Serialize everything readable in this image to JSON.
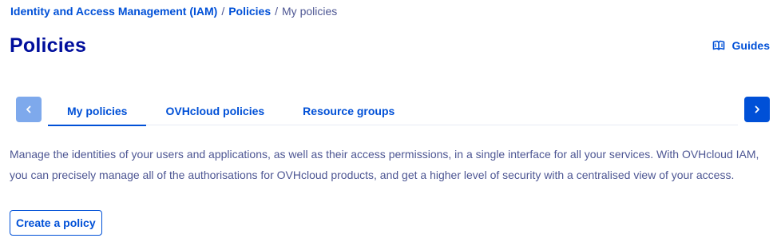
{
  "breadcrumb": {
    "items": [
      {
        "label": "Identity and Access Management (IAM)"
      },
      {
        "label": "Policies"
      }
    ],
    "separator": "/",
    "current": "My policies"
  },
  "page": {
    "title": "Policies"
  },
  "header_actions": {
    "guides_label": "Guides",
    "guides_icon": "book-icon"
  },
  "tabs": {
    "items": [
      {
        "label": "My policies",
        "active": true
      },
      {
        "label": "OVHcloud policies",
        "active": false
      },
      {
        "label": "Resource groups",
        "active": false
      }
    ],
    "prev_icon": "chevron-left-icon",
    "next_icon": "chevron-right-icon"
  },
  "description": "Manage the identities of your users and applications, as well as their access permissions, in a single interface for all your services. With OVHcloud IAM, you can precisely manage all of the authorisations for OVHcloud products, and get a higher level of security with a centralised view of your access.",
  "actions": {
    "create_policy_label": "Create a policy"
  },
  "colors": {
    "primary": "#0050d7",
    "title": "#000e9c",
    "text": "#4d5693",
    "disabled_arrow": "#7ea9ec",
    "divider": "#e6ebf5"
  }
}
